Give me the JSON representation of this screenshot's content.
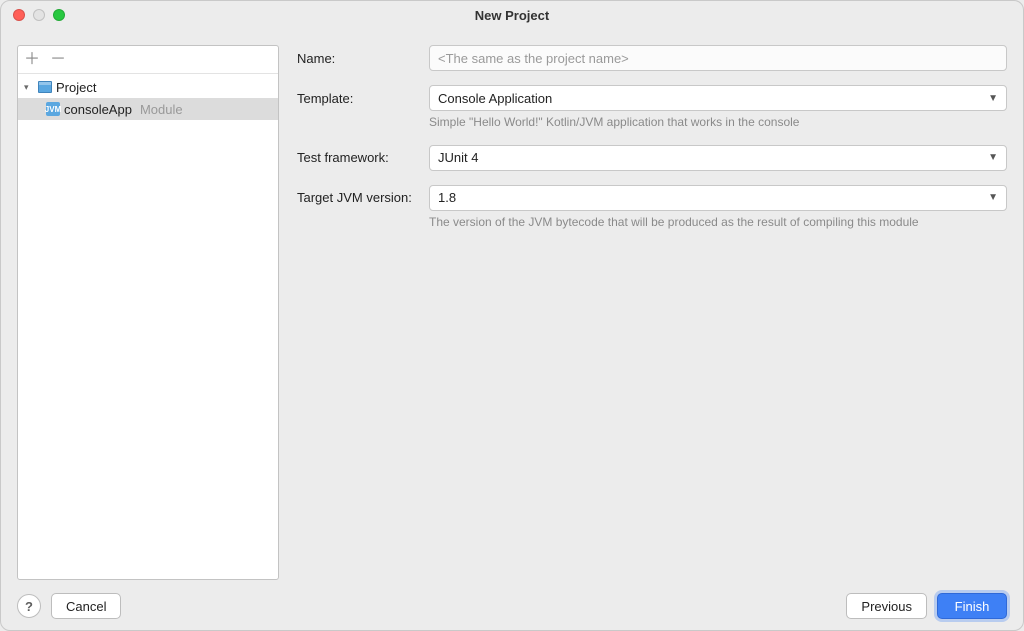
{
  "window": {
    "title": "New Project"
  },
  "sidebar": {
    "add_tooltip": "Add",
    "remove_tooltip": "Remove",
    "tree": {
      "project_label": "Project",
      "module_name": "consoleApp",
      "module_tag": "Module"
    }
  },
  "form": {
    "name_label": "Name:",
    "name_placeholder": "<The same as the project name>",
    "template_label": "Template:",
    "template_value": "Console Application",
    "template_hint": "Simple \"Hello World!\" Kotlin/JVM application that works in the console",
    "testfw_label": "Test framework:",
    "testfw_value": "JUnit 4",
    "jvm_label": "Target JVM version:",
    "jvm_value": "1.8",
    "jvm_hint": "The version of the JVM bytecode that will be produced as the result of compiling this module"
  },
  "buttons": {
    "help": "?",
    "cancel": "Cancel",
    "previous": "Previous",
    "finish": "Finish"
  }
}
